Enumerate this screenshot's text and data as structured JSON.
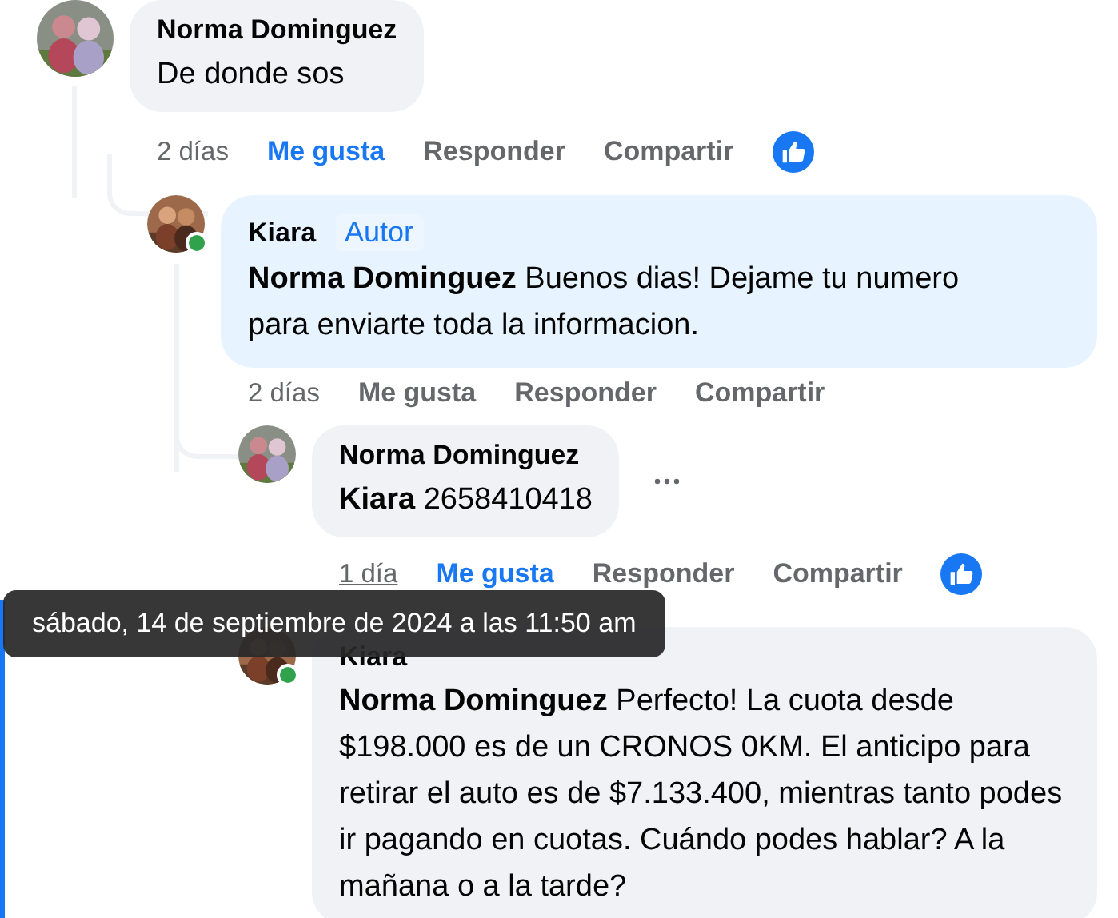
{
  "comments": [
    {
      "author": "Norma Dominguez",
      "text": "De donde sos",
      "highlighted": false,
      "time": "2 días",
      "time_hovered": false,
      "like_label": "Me gusta",
      "liked": true,
      "reply_label": "Responder",
      "share_label": "Compartir",
      "reaction_shown": true,
      "children": [
        {
          "author": "Kiara",
          "badge": "Autor",
          "mention": "Norma Dominguez",
          "text": "Buenos dias! Dejame tu numero para enviarte toda la informacion.",
          "highlighted": true,
          "time": "2 días",
          "time_hovered": false,
          "like_label": "Me gusta",
          "liked": false,
          "reply_label": "Responder",
          "share_label": "Compartir",
          "online": true,
          "children": [
            {
              "author": "Norma Dominguez",
              "mention": "Kiara",
              "text": "2658410418",
              "highlighted": false,
              "time": "1 día",
              "time_hovered": true,
              "like_label": "Me gusta",
              "liked": true,
              "reply_label": "Responder",
              "share_label": "Compartir",
              "reaction_shown": true,
              "more_menu": true
            },
            {
              "author": "Kiara",
              "mention": "Norma Dominguez",
              "text": "Perfecto! La cuota desde $198.000 es de un CRONOS 0KM. El anticipo para retirar el auto es de $7.133.400, mientras tanto podes ir pagando en cuotas. Cuándo podes hablar? A la mañana o a la tarde?",
              "highlighted": false,
              "online": true
            }
          ]
        }
      ]
    }
  ],
  "tooltip": {
    "text": "sábado, 14 de septiembre de 2024 a las 11:50 am"
  }
}
